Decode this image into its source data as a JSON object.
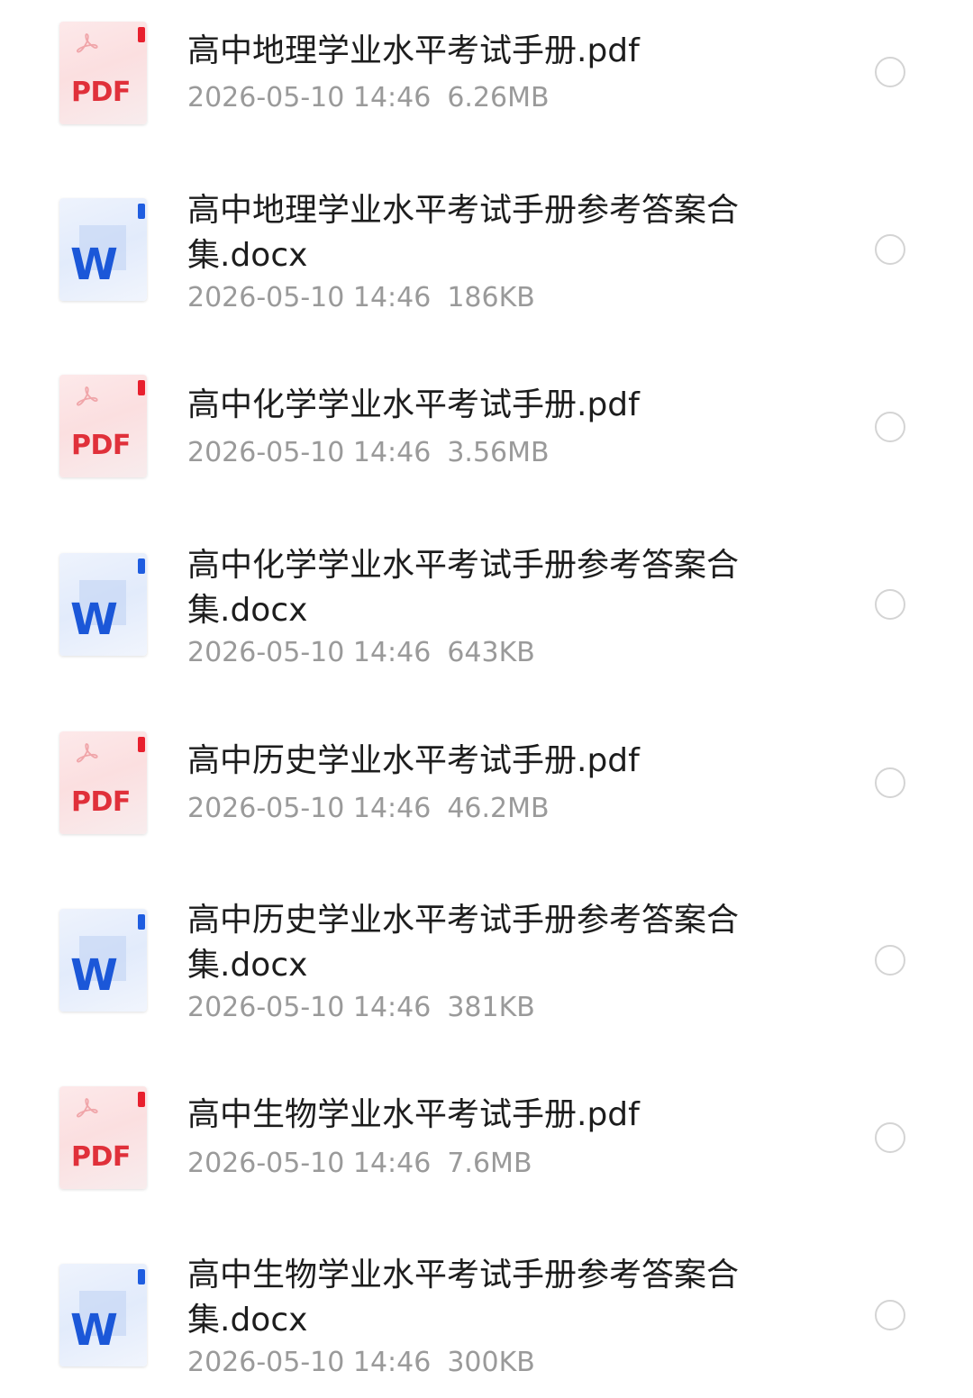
{
  "files": [
    {
      "type": "pdf",
      "icon": "pdf-file-icon",
      "icon_label": "PDF",
      "name": "高中地理学业水平考试手册.pdf",
      "date": "2026-05-10 14:46",
      "size": "6.26MB"
    },
    {
      "type": "word",
      "icon": "word-file-icon",
      "icon_label": "W",
      "name": "高中地理学业水平考试手册参考答案合集.docx",
      "date": "2026-05-10 14:46",
      "size": "186KB"
    },
    {
      "type": "pdf",
      "icon": "pdf-file-icon",
      "icon_label": "PDF",
      "name": "高中化学学业水平考试手册.pdf",
      "date": "2026-05-10 14:46",
      "size": "3.56MB"
    },
    {
      "type": "word",
      "icon": "word-file-icon",
      "icon_label": "W",
      "name": "高中化学学业水平考试手册参考答案合集.docx",
      "date": "2026-05-10 14:46",
      "size": "643KB"
    },
    {
      "type": "pdf",
      "icon": "pdf-file-icon",
      "icon_label": "PDF",
      "name": "高中历史学业水平考试手册.pdf",
      "date": "2026-05-10 14:46",
      "size": "46.2MB"
    },
    {
      "type": "word",
      "icon": "word-file-icon",
      "icon_label": "W",
      "name": "高中历史学业水平考试手册参考答案合集.docx",
      "date": "2026-05-10 14:46",
      "size": "381KB"
    },
    {
      "type": "pdf",
      "icon": "pdf-file-icon",
      "icon_label": "PDF",
      "name": "高中生物学业水平考试手册.pdf",
      "date": "2026-05-10 14:46",
      "size": "7.6MB"
    },
    {
      "type": "word",
      "icon": "word-file-icon",
      "icon_label": "W",
      "name": "高中生物学业水平考试手册参考答案合集.docx",
      "date": "2026-05-10 14:46",
      "size": "300KB"
    }
  ],
  "colors": {
    "pdf_accent": "#e8202e",
    "word_accent": "#1f5de0",
    "title_text": "#1d1d1d",
    "meta_text": "#9a9a9a",
    "radio_border": "#d4d4d4"
  }
}
